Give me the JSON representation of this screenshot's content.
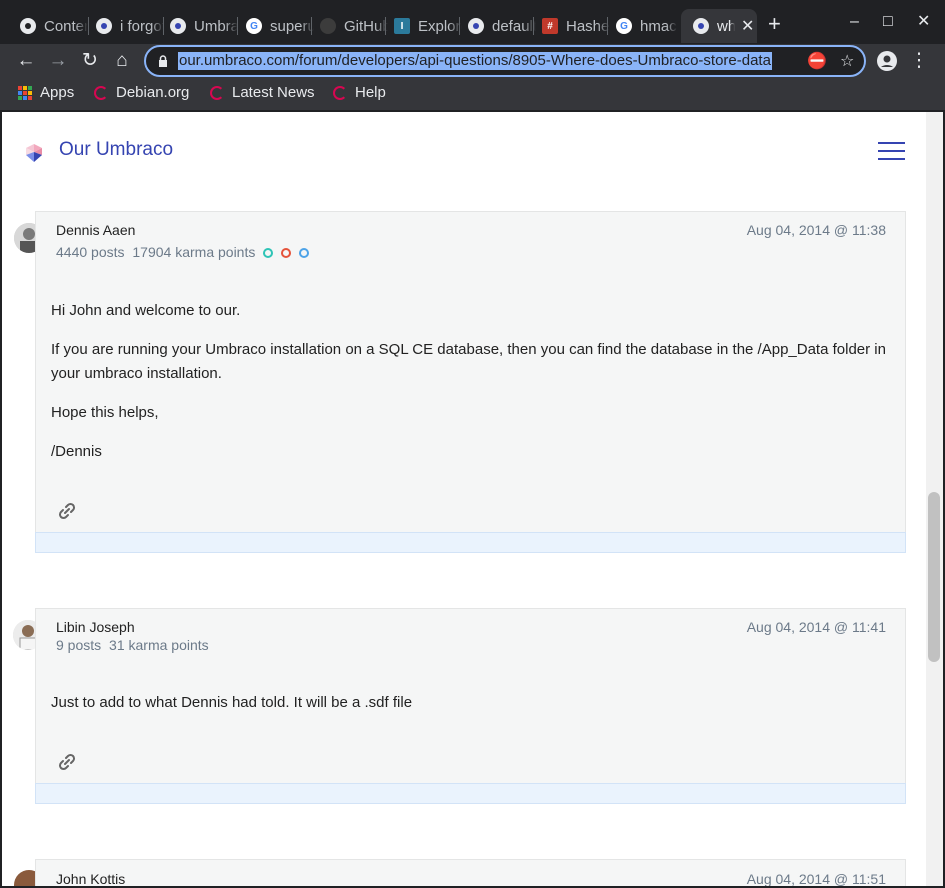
{
  "browser": {
    "tabs": [
      {
        "title": "Contents",
        "fav": "chrome",
        "favColor": "#e8eaed"
      },
      {
        "title": "i forgot",
        "fav": "umbraco",
        "favColor": "#e8eaed"
      },
      {
        "title": "Umbraco",
        "fav": "umbraco",
        "favColor": "#e8eaed"
      },
      {
        "title": "superuser",
        "fav": "google",
        "favColor": "#4285f4"
      },
      {
        "title": "GitHub",
        "fav": "github",
        "favColor": "#3c3c3c"
      },
      {
        "title": "Explore",
        "fav": "I",
        "favColor": "#2b7a9b"
      },
      {
        "title": "default",
        "fav": "umbraco",
        "favColor": "#e8eaed"
      },
      {
        "title": "Hashes",
        "fav": "hash",
        "favColor": "#c0392b"
      },
      {
        "title": "hmac",
        "fav": "google",
        "favColor": "#4285f4"
      },
      {
        "title": "where",
        "fav": "umbraco",
        "favColor": "#e8eaed",
        "active": true
      }
    ],
    "new_tab_label": "+",
    "window_controls": {
      "minimize": "–",
      "maximize": "□",
      "close": "✕"
    },
    "url": "our.umbraco.com/forum/developers/api-questions/8905-Where-does-Umbraco-store-data",
    "bookmarks": [
      {
        "label": "Apps",
        "icon": "apps-grid-icon"
      },
      {
        "label": "Debian.org",
        "icon": "debian-icon"
      },
      {
        "label": "Latest News",
        "icon": "debian-icon"
      },
      {
        "label": "Help",
        "icon": "debian-icon"
      }
    ]
  },
  "site": {
    "brand": "Our Umbraco"
  },
  "posts": [
    {
      "author": "Dennis Aaen",
      "posts_count": "4440 posts",
      "karma": "17904 karma points",
      "badges": [
        "#2ec4b6",
        "#e5533b",
        "#4da3e8"
      ],
      "date": "Aug 04, 2014 @ 11:38",
      "paragraphs": [
        "Hi John and welcome to our.",
        "If you are running your Umbraco installation on a SQL CE database, then you can find the database in the /App_Data folder in your umbraco installation.",
        "Hope this helps,",
        "/Dennis"
      ]
    },
    {
      "author": "Libin Joseph",
      "posts_count": "9 posts",
      "karma": "31 karma points",
      "badges": [],
      "date": "Aug 04, 2014 @ 11:41",
      "paragraphs": [
        "Just to add to what Dennis had told. It will be a .sdf file"
      ]
    },
    {
      "author": "John Kottis",
      "date": "Aug 04, 2014 @ 11:51"
    }
  ]
}
